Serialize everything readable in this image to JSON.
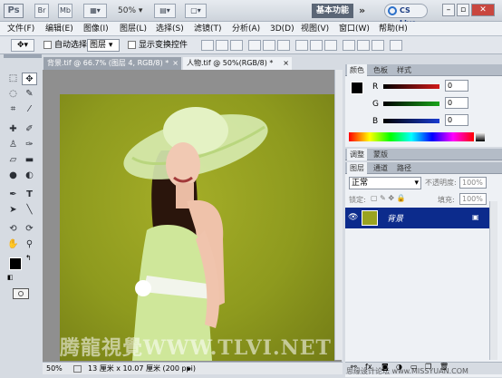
{
  "app": {
    "logo": "Ps",
    "bridge_label": "Br",
    "minibridge_label": "Mb",
    "zoom": "50%",
    "workspace_button": "基本功能",
    "more": "»",
    "cslive_label": "CS Live",
    "win_min": "–",
    "win_restore": "▫",
    "win_close": "✕"
  },
  "menu": [
    "文件(F)",
    "编辑(E)",
    "图像(I)",
    "图层(L)",
    "选择(S)",
    "滤镜(T)",
    "分析(A)",
    "3D(D)",
    "视图(V)",
    "窗口(W)",
    "帮助(H)"
  ],
  "options": {
    "auto_select_label": "自动选择:",
    "auto_select_value": "图层",
    "transform_label": "显示变换控件"
  },
  "document": {
    "tabs": [
      {
        "label": "背景.tif @ 66.7% (图层 4, RGB/8) *",
        "close": "×"
      },
      {
        "label": "人物.tif @ 50%(RGB/8) *",
        "close": "×"
      }
    ],
    "status_zoom": "50%",
    "status_info": "13 厘米 x 10.07 厘米 (200 ppi)"
  },
  "color_panel": {
    "tabs": [
      "颜色",
      "色板",
      "样式"
    ],
    "channels": [
      {
        "label": "R",
        "value": "0",
        "color": "#d21a1a"
      },
      {
        "label": "G",
        "value": "0",
        "color": "#19a51a"
      },
      {
        "label": "B",
        "value": "0",
        "color": "#1a3cd2"
      }
    ]
  },
  "adjust_panel": {
    "tabs": [
      "调整",
      "蒙版"
    ]
  },
  "layers_panel": {
    "tabs": [
      "图层",
      "通道",
      "路径"
    ],
    "blend_mode": "正常",
    "opacity_label": "不透明度:",
    "opacity_value": "100%",
    "lock_label": "锁定:",
    "fill_label": "填充:",
    "fill_value": "100%",
    "layer_name": "背景"
  },
  "colors": {
    "accent": "#0c2b8c",
    "photo_bg": "#9aa320"
  },
  "watermark": {
    "main": "腾龍視覺WWW.TLVI.NET",
    "corner": "思缘设计论坛 www.MISSYUAN.COM"
  }
}
